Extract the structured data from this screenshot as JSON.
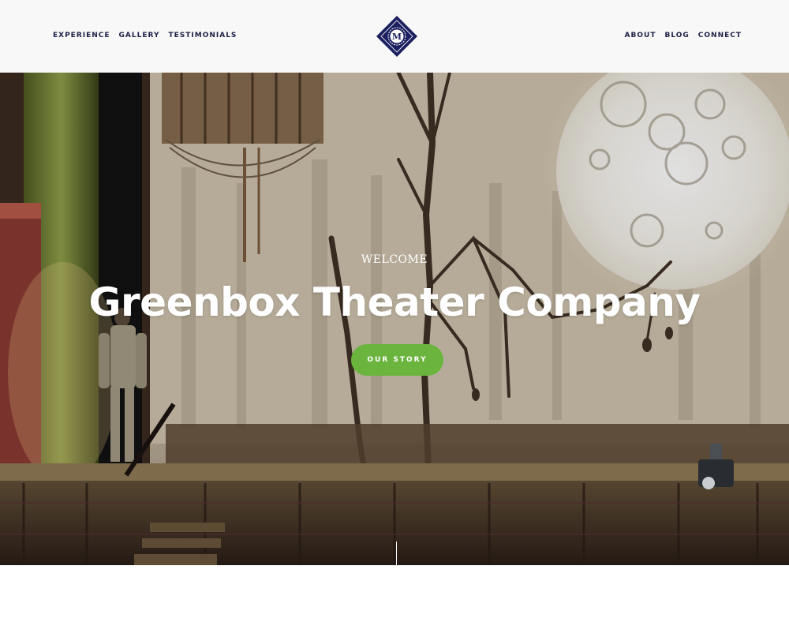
{
  "header": {
    "nav_left": [
      "EXPERIENCE",
      "GALLERY",
      "TESTIMONIALS"
    ],
    "nav_right": [
      "ABOUT",
      "BLOG",
      "CONNECT"
    ],
    "logo_letter": "M"
  },
  "hero": {
    "eyebrow": "WELCOME",
    "title": "Greenbox Theater Company",
    "cta_label": "OUR STORY"
  },
  "colors": {
    "nav_text": "#1b1f45",
    "logo_navy": "#1b1f60",
    "cta_green": "#6bb53f",
    "header_bg": "#f8f8f8"
  },
  "icons": {
    "logo": "diamond-monogram-icon"
  }
}
